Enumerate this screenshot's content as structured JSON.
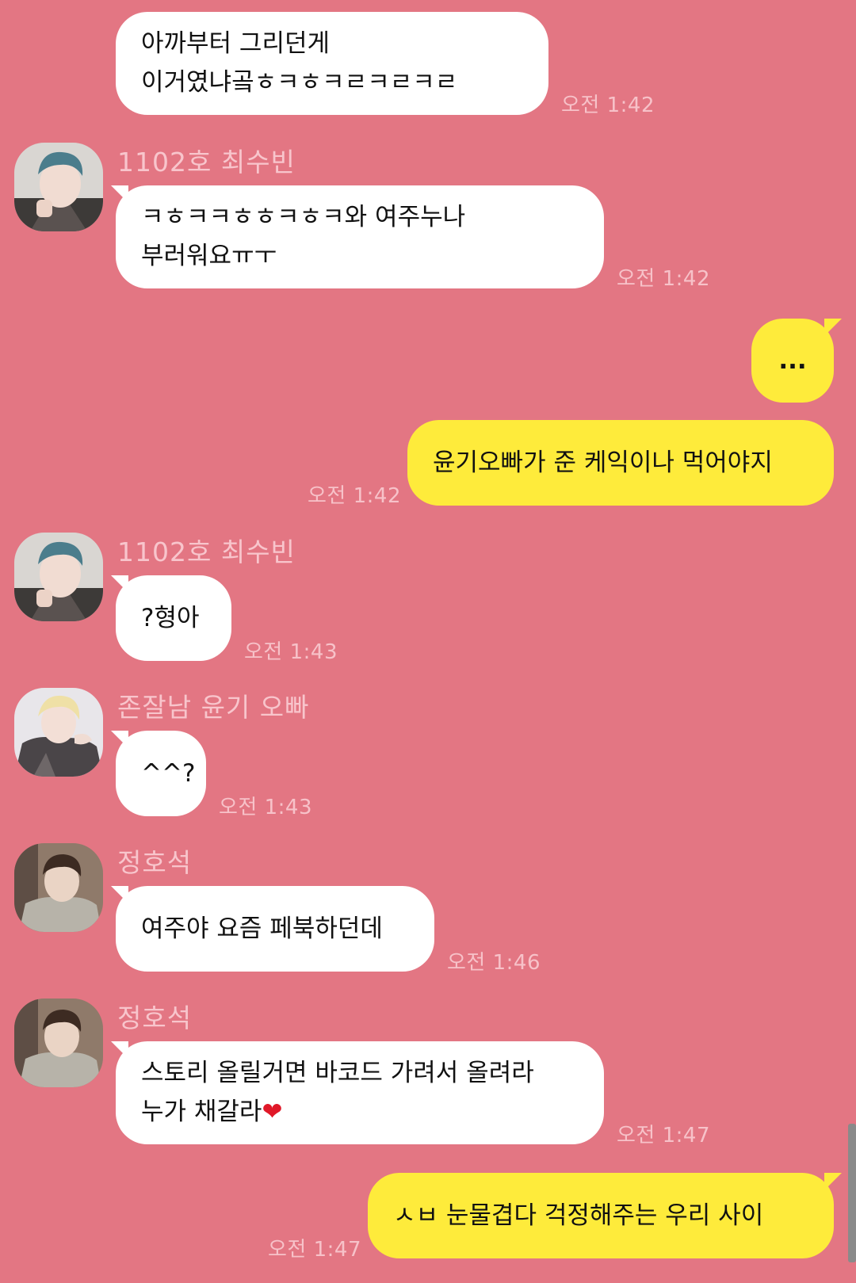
{
  "messages": [
    {
      "lines": [
        "아까부터 그리던게",
        "이거였냐곸ㅎㅋㅎㅋㄹㅋㄹㅋㄹ"
      ],
      "time": "오전 1:42"
    },
    {
      "sender": "1102호 최수빈",
      "lines": [
        "ㅋㅎㅋㅋㅎㅎㅋㅎㅋ와 여주누나",
        "부러워요ㅠㅜ"
      ],
      "time": "오전 1:42"
    },
    {
      "lines": [
        "..."
      ]
    },
    {
      "lines": [
        "윤기오빠가 준 케익이나 먹어야지"
      ],
      "time": "오전 1:42"
    },
    {
      "sender": "1102호 최수빈",
      "lines": [
        "?형아"
      ],
      "time": "오전 1:43"
    },
    {
      "sender": "존잘남 윤기 오빠",
      "lines": [
        "^^?"
      ],
      "time": "오전 1:43"
    },
    {
      "sender": "정호석",
      "lines": [
        "여주야 요즘 페북하던데"
      ],
      "time": "오전 1:46"
    },
    {
      "sender": "정호석",
      "lines": [
        "스토리 올릴거면 바코드 가려서 올려라",
        "누가 채갈라"
      ],
      "heart": "❤",
      "time": "오전 1:47"
    },
    {
      "lines": [
        "ㅅㅂ 눈물겹다 걱정해주는 우리 사이"
      ],
      "time": "오전 1:47"
    }
  ],
  "colors": {
    "background": "#e37683",
    "incoming_bubble": "#ffffff",
    "outgoing_bubble": "#feeb3b",
    "timestamp": "#f7c2c9",
    "sender_name": "#f8c5cc"
  },
  "avatars": [
    "profile-photo-1102-choi-soobin",
    "profile-photo-yoongi",
    "profile-photo-jung-hoseok"
  ]
}
